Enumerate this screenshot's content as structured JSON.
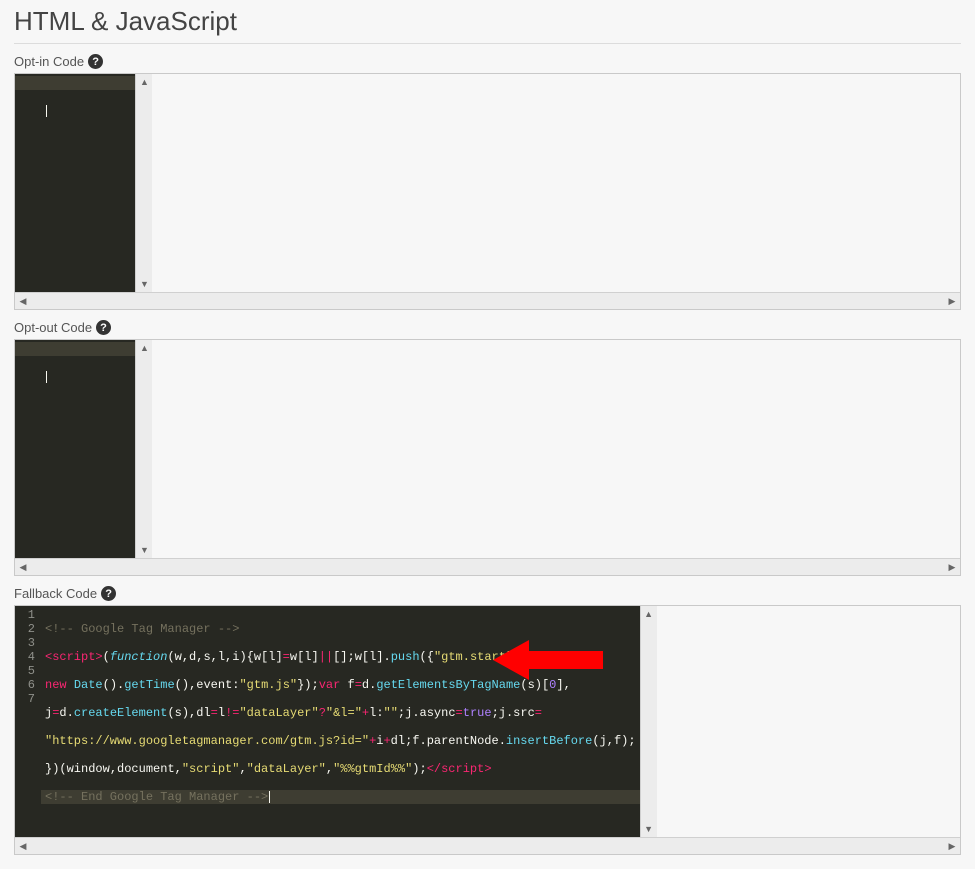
{
  "heading": "HTML & JavaScript",
  "sections": {
    "optin": {
      "label": "Opt-in Code"
    },
    "optout": {
      "label": "Opt-out Code"
    },
    "fallback": {
      "label": "Fallback Code"
    }
  },
  "fallback_code": {
    "line1": "<!-- Google Tag Manager -->",
    "line2": {
      "t_open": "<",
      "t_name": "script",
      "t_close": ">",
      "paren_o": "(",
      "kw_function": "function",
      "args": "(w,d,s,l,i)",
      "brace_o": "{",
      "expr1": "w[l]",
      "eq": "=",
      "expr2": "w[l]",
      "or": "||",
      "arr": "[]",
      "semi": ";",
      "expr3": "w[l]",
      "dot": ".",
      "push": "push",
      "paren_o2": "(",
      "brace_o2": "{",
      "key": "\"gtm.start\"",
      "colon": ":"
    },
    "line3": {
      "kw_new": "new",
      "sp": " ",
      "date": "Date",
      "paren": "()",
      "dot": ".",
      "gettime": "getTime",
      "paren2": "()",
      "comma": ",",
      "evkey": "event",
      "colon": ":",
      "evval": "\"gtm.js\"",
      "brace_c": "}",
      "paren_c": ")",
      "semi": ";",
      "kw_var": "var",
      "sp2": " ",
      "f": "f",
      "eq": "=",
      "d": "d",
      "dot2": ".",
      "gbtn": "getElementsByTagName",
      "paren_o": "(",
      "s": "s",
      "paren_c2": ")",
      "idx_o": "[",
      "zero": "0",
      "idx_c": "]",
      "comma2": ","
    },
    "line4": {
      "j": "j",
      "eq": "=",
      "d": "d",
      "dot": ".",
      "ce": "createElement",
      "paren_o": "(",
      "s": "s",
      "paren_c": ")",
      "comma": ",",
      "dl": "dl",
      "eq2": "=",
      "l": "l",
      "neq": "!=",
      "dlstr": "\"dataLayer\"",
      "q": "?",
      "amp": "\"&l=\"",
      "plus": "+",
      "l2": "l",
      "colon": ":",
      "empty": "\"\"",
      "semi": ";",
      "j2": "j",
      "dot2": ".",
      "async": "async",
      "eq3": "=",
      "true": "true",
      "semi2": ";",
      "j3": "j",
      "dot3": ".",
      "src": "src",
      "eq4": "="
    },
    "line5": {
      "url": "\"https://www.googletagmanager.com/gtm.js?id=\"",
      "plus": "+",
      "i": "i",
      "plus2": "+",
      "dl": "dl",
      "semi": ";",
      "f": "f",
      "dot": ".",
      "pn": "parentNode",
      "dot2": ".",
      "ib": "insertBefore",
      "paren_o": "(",
      "j": "j",
      "comma": ",",
      "f2": "f",
      "paren_c": ")",
      "semi2": ";"
    },
    "line6": {
      "brace_c": "}",
      "paren_c": ")",
      "paren_o": "(",
      "win": "window",
      "comma": ",",
      "doc": "document",
      "comma2": ",",
      "script": "\"script\"",
      "comma3": ",",
      "datalayer": "\"dataLayer\"",
      "comma4": ",",
      "gtmid": "\"%%gtmId%%\"",
      "paren_c2": ")",
      "semi": ";",
      "ct_open": "</",
      "ct_name": "script",
      "ct_close": ">"
    },
    "line7": "<!-- End Google Tag Manager -->"
  },
  "annotation": {
    "arrow_color": "#ff0000"
  }
}
